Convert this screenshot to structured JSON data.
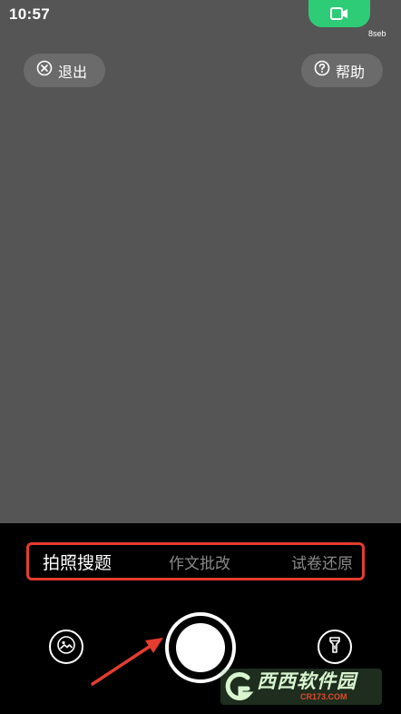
{
  "status_bar": {
    "time": "10:57",
    "recording_label": "8seb"
  },
  "top_actions": {
    "exit_label": "退出",
    "help_label": "帮助"
  },
  "modes": [
    {
      "label": "拍照搜题",
      "active": true
    },
    {
      "label": "作文批改",
      "active": false
    },
    {
      "label": "试卷还原",
      "active": false
    }
  ],
  "colors": {
    "viewfinder": "#555555",
    "record_green": "#2fcc78",
    "highlight_red": "#e53c2e"
  },
  "icons": [
    "video-camera-icon",
    "close-circle-icon",
    "help-circle-icon",
    "gallery-icon",
    "flashlight-icon"
  ],
  "watermark": {
    "brand": "西西软件园",
    "domain": "CR173.COM"
  }
}
